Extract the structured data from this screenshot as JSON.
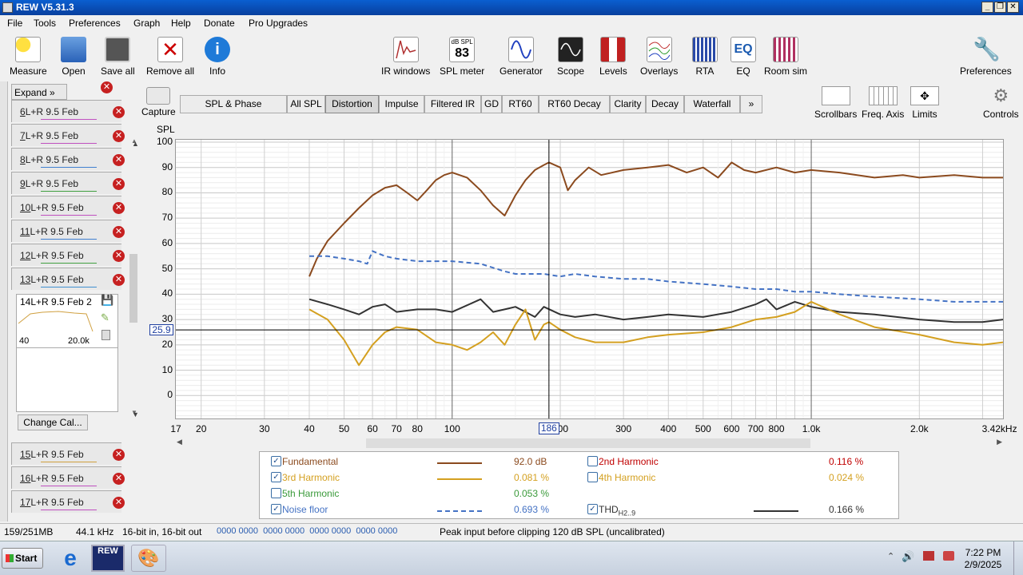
{
  "window": {
    "title": "REW V5.31.3"
  },
  "menu": [
    "File",
    "Tools",
    "Preferences",
    "Graph",
    "Help",
    "Donate",
    "Pro Upgrades"
  ],
  "toolbar": {
    "left": [
      {
        "label": "Measure",
        "icon": "measure-icon"
      },
      {
        "label": "Open",
        "icon": "folder-icon"
      },
      {
        "label": "Save all",
        "icon": "save-icon"
      },
      {
        "label": "Remove all",
        "icon": "remove-all-icon"
      },
      {
        "label": "Info",
        "icon": "info-icon"
      }
    ],
    "center": [
      {
        "label": "IR windows",
        "icon": "ir-windows-icon"
      },
      {
        "label": "SPL meter",
        "icon": "spl-meter-icon",
        "badge": "83",
        "badge_top": "dB SPL"
      },
      {
        "label": "Generator",
        "icon": "generator-icon"
      },
      {
        "label": "Scope",
        "icon": "scope-icon"
      },
      {
        "label": "Levels",
        "icon": "levels-icon"
      },
      {
        "label": "Overlays",
        "icon": "overlays-icon"
      },
      {
        "label": "RTA",
        "icon": "rta-icon"
      },
      {
        "label": "EQ",
        "icon": "eq-icon"
      },
      {
        "label": "Room sim",
        "icon": "room-sim-icon"
      }
    ],
    "right": {
      "label": "Preferences",
      "icon": "wrench-icon"
    }
  },
  "sidebar": {
    "expand": "Expand",
    "measurements": [
      {
        "num": "6",
        "name": "L+R 9.5 Feb",
        "color": "#c050c0"
      },
      {
        "num": "7",
        "name": "L+R 9.5 Feb",
        "color": "#c050c0"
      },
      {
        "num": "8",
        "name": "L+R 9.5 Feb",
        "color": "#4080d0"
      },
      {
        "num": "9",
        "name": "L+R 9.5 Feb",
        "color": "#40a040"
      },
      {
        "num": "10",
        "name": "L+R 9.5 Feb",
        "color": "#c050c0"
      },
      {
        "num": "11",
        "name": "L+R 9.5 Feb",
        "color": "#4080d0"
      },
      {
        "num": "12",
        "name": "L+R 9.5 Feb",
        "color": "#40a040"
      },
      {
        "num": "13",
        "name": "L+R 9.5 Feb",
        "color": "#4090d0"
      }
    ],
    "selected": {
      "num": "14",
      "name": "L+R 9.5 Feb 2",
      "range_lo": "40",
      "range_hi": "20.0k"
    },
    "change_cal": "Change Cal...",
    "lower": [
      {
        "num": "15",
        "name": "L+R 9.5 Feb",
        "color": "#d0a040"
      },
      {
        "num": "16",
        "name": "L+R 9.5 Feb",
        "color": "#c050c0"
      },
      {
        "num": "17",
        "name": "L+R 9.5 Feb",
        "color": "#c050c0"
      }
    ]
  },
  "capture": "Capture",
  "tabs": [
    "SPL & Phase",
    "All SPL",
    "Distortion",
    "Impulse",
    "Filtered IR",
    "GD",
    "RT60",
    "RT60 Decay",
    "Clarity",
    "Decay",
    "Waterfall",
    "»"
  ],
  "selected_tab": "Distortion",
  "graph_controls": [
    {
      "label": "Scrollbars"
    },
    {
      "label": "Freq. Axis"
    },
    {
      "label": "Limits"
    },
    {
      "label": "Controls"
    }
  ],
  "chart_data": {
    "type": "line",
    "ylabel": "SPL",
    "ylim": [
      -10,
      100
    ],
    "yticks": [
      "100",
      "90",
      "80",
      "70",
      "60",
      "50",
      "40",
      "30",
      "20",
      "10",
      "0"
    ],
    "xlim": [
      17,
      3420
    ],
    "xscale": "log",
    "xticks": [
      {
        "v": 17,
        "t": "17"
      },
      {
        "v": 20,
        "t": "20"
      },
      {
        "v": 30,
        "t": "30"
      },
      {
        "v": 40,
        "t": "40"
      },
      {
        "v": 50,
        "t": "50"
      },
      {
        "v": 60,
        "t": "60"
      },
      {
        "v": 70,
        "t": "70"
      },
      {
        "v": 80,
        "t": "80"
      },
      {
        "v": 100,
        "t": "100"
      },
      {
        "v": 200,
        "t": "200"
      },
      {
        "v": 300,
        "t": "300"
      },
      {
        "v": 400,
        "t": "400"
      },
      {
        "v": 500,
        "t": "500"
      },
      {
        "v": 600,
        "t": "600"
      },
      {
        "v": 700,
        "t": "700"
      },
      {
        "v": 800,
        "t": "800"
      },
      {
        "v": 1000,
        "t": "1.0k"
      },
      {
        "v": 2000,
        "t": "2.0k"
      },
      {
        "v": 3420,
        "t": "3.42kHz"
      }
    ],
    "cursor": {
      "x": 186,
      "y": 25.9,
      "x_label": "186",
      "y_label": "25.9"
    },
    "series": [
      {
        "name": "Fundamental",
        "color": "#8b4a1e",
        "dash": false,
        "x": [
          40,
          42,
          45,
          50,
          55,
          60,
          65,
          70,
          75,
          80,
          85,
          90,
          95,
          100,
          110,
          120,
          130,
          140,
          150,
          160,
          170,
          180,
          186,
          200,
          210,
          220,
          240,
          260,
          300,
          350,
          400,
          450,
          500,
          550,
          600,
          650,
          700,
          800,
          900,
          1000,
          1200,
          1500,
          1800,
          2000,
          2500,
          3000,
          3420
        ],
        "y": [
          47,
          54,
          61,
          68,
          74,
          79,
          82,
          83,
          80,
          77,
          81,
          85,
          87,
          88,
          86,
          81,
          75,
          71,
          79,
          85,
          89,
          91,
          92,
          90,
          81,
          85,
          90,
          87,
          89,
          90,
          91,
          88,
          90,
          86,
          92,
          89,
          88,
          90,
          88,
          89,
          88,
          86,
          87,
          86,
          87,
          86,
          86
        ]
      },
      {
        "name": "Noise floor",
        "color": "#4472c4",
        "dash": true,
        "x": [
          40,
          45,
          50,
          55,
          58,
          60,
          65,
          70,
          80,
          100,
          120,
          140,
          150,
          160,
          180,
          200,
          220,
          250,
          300,
          350,
          400,
          500,
          600,
          700,
          800,
          900,
          1000,
          1200,
          1500,
          2000,
          2500,
          3000,
          3420
        ],
        "y": [
          55,
          55,
          54,
          53,
          52,
          57,
          55,
          54,
          53,
          53,
          52,
          49,
          48,
          48,
          48,
          47,
          48,
          47,
          46,
          46,
          45,
          44,
          43,
          42,
          42,
          41,
          41,
          40,
          39,
          38,
          37,
          37,
          37
        ]
      },
      {
        "name": "THD H2..9",
        "color": "#333333",
        "dash": false,
        "x": [
          40,
          45,
          50,
          55,
          60,
          65,
          70,
          80,
          90,
          100,
          120,
          130,
          140,
          150,
          160,
          170,
          180,
          200,
          220,
          250,
          300,
          350,
          400,
          500,
          600,
          700,
          750,
          800,
          900,
          1000,
          1200,
          1500,
          2000,
          2500,
          3000,
          3420
        ],
        "y": [
          38,
          36,
          34,
          32,
          35,
          36,
          33,
          34,
          34,
          33,
          38,
          33,
          34,
          35,
          33,
          31,
          35,
          32,
          31,
          32,
          30,
          31,
          32,
          31,
          33,
          36,
          38,
          34,
          37,
          35,
          33,
          32,
          30,
          29,
          29,
          30
        ]
      },
      {
        "name": "3rd Harmonic",
        "color": "#d4a020",
        "dash": false,
        "x": [
          40,
          45,
          50,
          55,
          60,
          65,
          70,
          80,
          90,
          100,
          110,
          120,
          130,
          140,
          150,
          160,
          170,
          180,
          186,
          200,
          220,
          250,
          300,
          350,
          400,
          500,
          600,
          700,
          800,
          900,
          1000,
          1200,
          1500,
          2000,
          2500,
          3000,
          3420
        ],
        "y": [
          34,
          30,
          22,
          12,
          20,
          25,
          27,
          26,
          21,
          20,
          18,
          21,
          25,
          20,
          28,
          34,
          22,
          28,
          29,
          26,
          23,
          21,
          21,
          23,
          24,
          25,
          27,
          30,
          31,
          33,
          37,
          32,
          27,
          24,
          21,
          20,
          21
        ]
      }
    ]
  },
  "legend": [
    {
      "name": "Fundamental",
      "checked": true,
      "value": "92.0 dB",
      "color": "#8b4a1e",
      "line": true,
      "dash": false
    },
    {
      "name": "3rd Harmonic",
      "checked": true,
      "value": "0.081 %",
      "color": "#d4a020",
      "line": true,
      "dash": false
    },
    {
      "name": "5th Harmonic",
      "checked": false,
      "value": "0.053 %",
      "color": "#3a9a3a",
      "line": false,
      "dash": false
    },
    {
      "name": "Noise floor",
      "checked": true,
      "value": "0.693 %",
      "color": "#4472c4",
      "line": true,
      "dash": true
    },
    {
      "name": "2nd Harmonic",
      "checked": false,
      "value": "0.116 %",
      "color": "#c00000",
      "line": false,
      "dash": false
    },
    {
      "name": "4th Harmonic",
      "checked": false,
      "value": "0.024 %",
      "color": "#d4a020",
      "line": false,
      "dash": false
    },
    {
      "name": "THD",
      "sub": "H2..9",
      "checked": true,
      "value": "0.166 %",
      "color": "#333333",
      "line": true,
      "dash": false
    }
  ],
  "status": {
    "memory": "159/251MB",
    "rate": "44.1 kHz",
    "bits": "16-bit in, 16-bit out",
    "levels": "0000 0000  0000 0000  0000 0000  0000 0000",
    "peak": "Peak input before clipping 120 dB SPL (uncalibrated)"
  },
  "taskbar": {
    "start": "Start",
    "time": "7:22 PM",
    "date": "2/9/2025"
  }
}
